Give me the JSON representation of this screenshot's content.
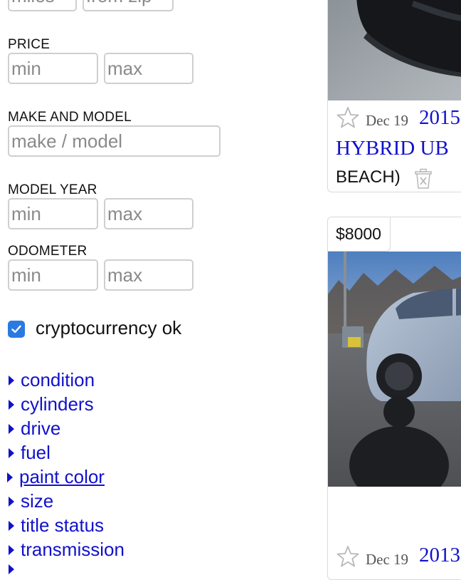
{
  "top_fields": {
    "miles_placeholder": "miles",
    "zip_placeholder": "from zip"
  },
  "price": {
    "label": "PRICE",
    "min_placeholder": "min",
    "max_placeholder": "max"
  },
  "make_model": {
    "label": "MAKE AND MODEL",
    "placeholder": "make / model"
  },
  "model_year": {
    "label": "MODEL YEAR",
    "min_placeholder": "min",
    "max_placeholder": "max"
  },
  "odometer": {
    "label": "ODOMETER",
    "min_placeholder": "min",
    "max_placeholder": "max"
  },
  "crypto": {
    "label": "cryptocurrency ok",
    "checked": true
  },
  "filters": [
    {
      "label": "condition"
    },
    {
      "label": "cylinders"
    },
    {
      "label": "drive"
    },
    {
      "label": "fuel"
    },
    {
      "label": "paint color"
    },
    {
      "label": "size"
    },
    {
      "label": "title status"
    },
    {
      "label": "transmission"
    }
  ],
  "listings": [
    {
      "date": "Dec 19",
      "title_line1": "2015",
      "title_line2": "HYBRID UB",
      "location": "BEACH)"
    },
    {
      "price": "$8000",
      "date": "Dec 19",
      "title_line1": "2013"
    }
  ],
  "colors": {
    "link": "#1111cc",
    "accent": "#2a7ae2"
  }
}
